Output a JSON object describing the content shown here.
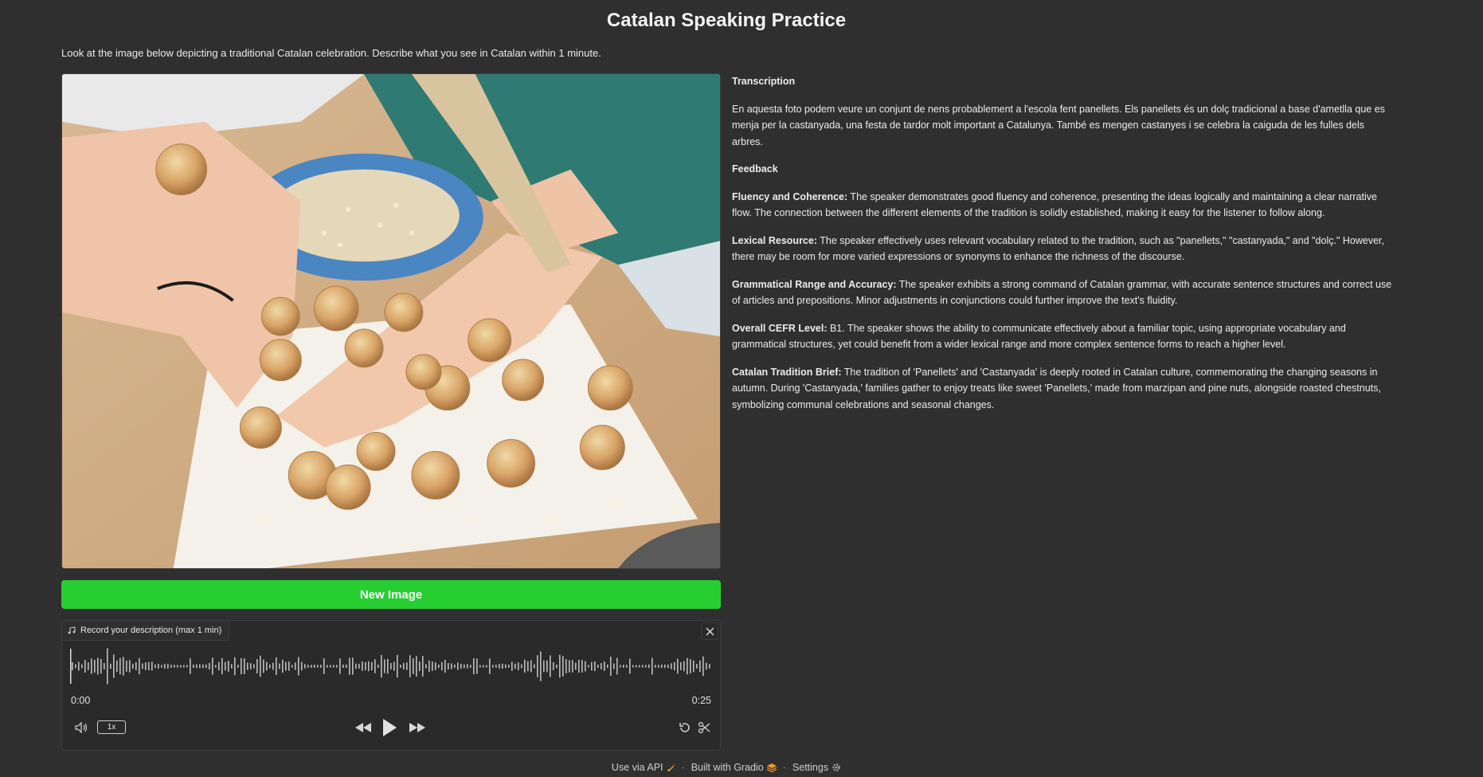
{
  "page": {
    "title": "Catalan Speaking Practice",
    "instruction": "Look at the image below depicting a traditional Catalan celebration. Describe what you see in Catalan within 1 minute."
  },
  "image_panel": {
    "subject": "Children making panellets with pine nuts on a parchment-covered table"
  },
  "new_image_button": {
    "label": "New Image"
  },
  "audio": {
    "label": "Record your description (max 1 min)",
    "time_start": "0:00",
    "time_end": "0:25",
    "speed_label": "1x",
    "icons": {
      "label": "music-note-icon",
      "close": "close-icon",
      "volume": "volume-icon",
      "rewind": "rewind-icon",
      "play": "play-icon",
      "forward": "fast-forward-icon",
      "reset": "undo-icon",
      "trim": "scissors-icon"
    }
  },
  "results": {
    "transcription_heading": "Transcription",
    "transcription": "En aquesta foto podem veure un conjunt de nens probablement a l'escola fent panellets. Els panellets és un dolç tradicional a base d'ametlla que es menja per la castanyada, una festa de tardor molt important a Catalunya. També es mengen castanyes i se celebra la caiguda de les fulles dels arbres.",
    "feedback_heading": "Feedback",
    "feedback": [
      {
        "label": "Fluency and Coherence:",
        "text": " The speaker demonstrates good fluency and coherence, presenting the ideas logically and maintaining a clear narrative flow. The connection between the different elements of the tradition is solidly established, making it easy for the listener to follow along."
      },
      {
        "label": "Lexical Resource:",
        "text": " The speaker effectively uses relevant vocabulary related to the tradition, such as \"panellets,\" \"castanyada,\" and \"dolç.\" However, there may be room for more varied expressions or synonyms to enhance the richness of the discourse."
      },
      {
        "label": "Grammatical Range and Accuracy:",
        "text": " The speaker exhibits a strong command of Catalan grammar, with accurate sentence structures and correct use of articles and prepositions. Minor adjustments in conjunctions could further improve the text's fluidity."
      },
      {
        "label": "Overall CEFR Level:",
        "text": " B1. The speaker shows the ability to communicate effectively about a familiar topic, using appropriate vocabulary and grammatical structures, yet could benefit from a wider lexical range and more complex sentence forms to reach a higher level."
      },
      {
        "label": "Catalan Tradition Brief:",
        "text": " The tradition of 'Panellets' and 'Castanyada' is deeply rooted in Catalan culture, commemorating the changing seasons in autumn. During 'Castanyada,' families gather to enjoy treats like sweet 'Panellets,' made from marzipan and pine nuts, alongside roasted chestnuts, symbolizing communal celebrations and seasonal changes."
      }
    ]
  },
  "footer": {
    "api": "Use via API",
    "built": "Built with Gradio",
    "settings": "Settings",
    "separator": "·"
  },
  "colors": {
    "background": "#2f2f2f",
    "accent_green": "#27ce32",
    "panel": "#2a2a2a"
  }
}
